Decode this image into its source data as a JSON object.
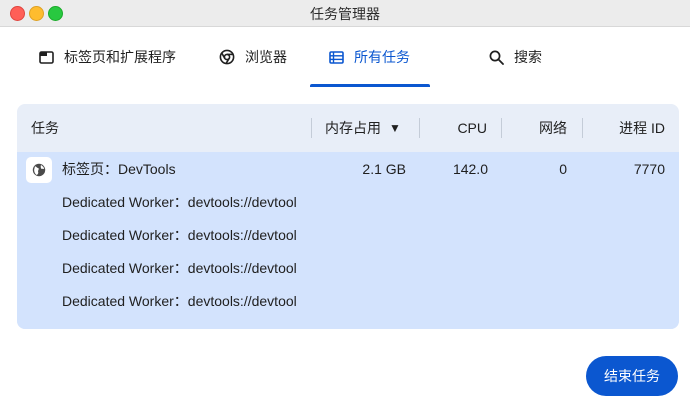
{
  "window": {
    "title": "任务管理器"
  },
  "tabs": [
    {
      "label": "标签页和扩展程序",
      "icon": "tab-icon"
    },
    {
      "label": "浏览器",
      "icon": "chrome-icon"
    },
    {
      "label": "所有任务",
      "icon": "list-icon",
      "active": true
    },
    {
      "label": "搜索",
      "icon": "search-icon"
    }
  ],
  "table": {
    "columns": {
      "task": "任务",
      "memory": "内存占用",
      "sort_indicator": "▼",
      "cpu": "CPU",
      "network": "网络",
      "pid": "进程 ID"
    },
    "rows": [
      {
        "task": "标签页：DevTools",
        "icon": "globe-icon",
        "memory": "2.1 GB",
        "cpu": "142.0",
        "network": "0",
        "pid": "7770"
      },
      {
        "task": "Dedicated Worker：devtools://devtool"
      },
      {
        "task": "Dedicated Worker：devtools://devtool"
      },
      {
        "task": "Dedicated Worker：devtools://devtool"
      },
      {
        "task": "Dedicated Worker：devtools://devtool"
      }
    ]
  },
  "footer": {
    "end_task_label": "结束任务"
  },
  "colors": {
    "accent": "#0b57d0",
    "selected_row": "#d3e3fd",
    "table_bg": "#e8eef8"
  }
}
